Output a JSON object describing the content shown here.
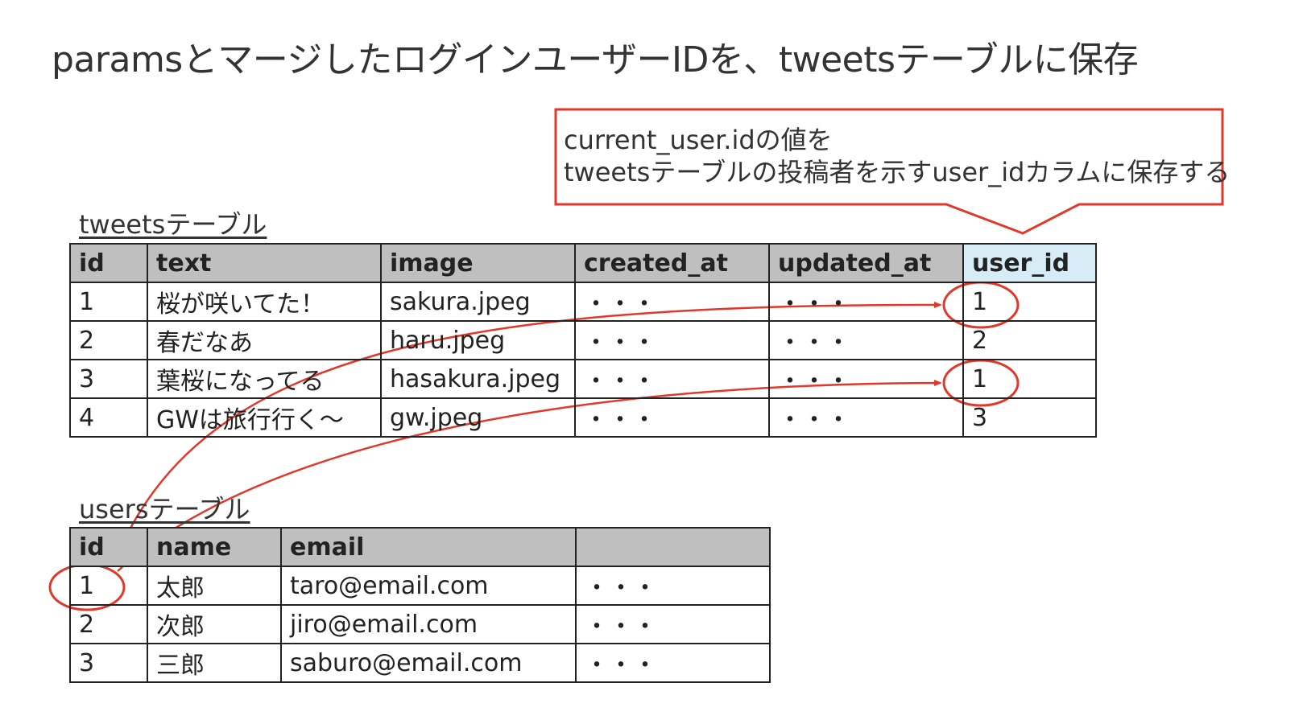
{
  "title": "paramsとマージしたログインユーザーIDを、tweetsテーブルに保存",
  "callout": {
    "line1": "current_user.idの値を",
    "line2": "tweetsテーブルの投稿者を示すuser_idカラムに保存する"
  },
  "tweets_table": {
    "caption": "tweetsテーブル",
    "headers": [
      "id",
      "text",
      "image",
      "created_at",
      "updated_at",
      "user_id"
    ],
    "rows": [
      [
        "1",
        "桜が咲いてた！",
        "sakura.jpeg",
        "・・・",
        "・・・",
        "1"
      ],
      [
        "2",
        "春だなあ",
        "haru.jpeg",
        "・・・",
        "・・・",
        "2"
      ],
      [
        "3",
        "葉桜になってる",
        "hasakura.jpeg",
        "・・・",
        "・・・",
        "1"
      ],
      [
        "4",
        "GWは旅行行く〜",
        "gw.jpeg",
        "・・・",
        "・・・",
        "3"
      ]
    ]
  },
  "users_table": {
    "caption": "usersテーブル",
    "headers": [
      "id",
      "name",
      "email",
      ""
    ],
    "rows": [
      [
        "1",
        "太郎",
        "taro@email.com",
        "・・・"
      ],
      [
        "2",
        "次郎",
        "jiro@email.com",
        "・・・"
      ],
      [
        "3",
        "三郎",
        "saburo@email.com",
        "・・・"
      ]
    ]
  },
  "colors": {
    "annotation_red": "#e0392b",
    "header_gray": "#bfbfbf",
    "highlight_header": "#d6ecf7"
  }
}
